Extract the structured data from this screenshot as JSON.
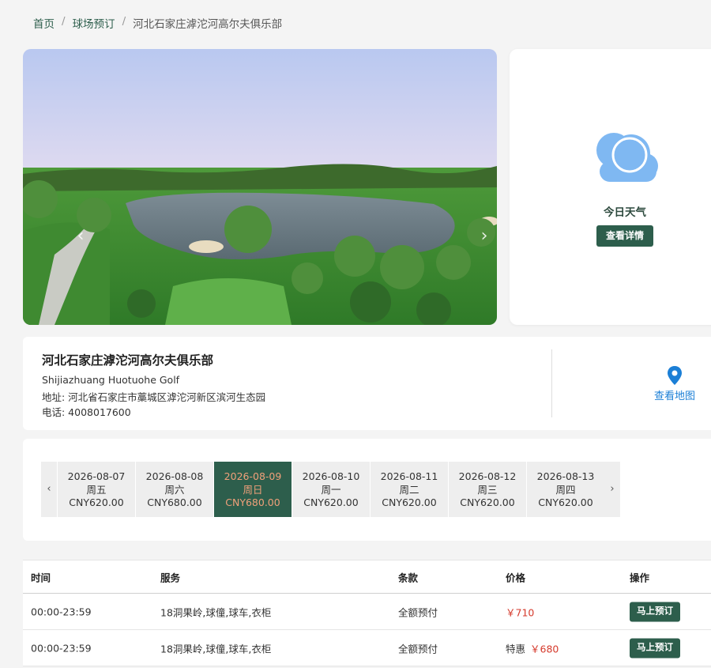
{
  "breadcrumb": {
    "home": "首页",
    "booking": "球场预订",
    "current": "河北石家庄滹沱河高尔夫俱乐部",
    "separator": "/"
  },
  "carousel": {
    "prev_icon": "‹",
    "next_icon": "›",
    "slide_count": 3,
    "active_slide": 1
  },
  "weather": {
    "label": "今日天气",
    "button": "查看详情",
    "icon": "cloud-icon"
  },
  "club": {
    "name": "河北石家庄滹沱河高尔夫俱乐部",
    "english_name": "Shijiazhuang Huotuohe Golf",
    "address": "地址: 河北省石家庄市藁城区滹沱河新区滨河生态园",
    "phone": "电话: 4008017600",
    "map_link": "查看地图",
    "map_icon": "location-pin-icon"
  },
  "date_picker": {
    "prev": "‹",
    "next": "›",
    "dates": [
      {
        "date": "2026-08-07",
        "weekday": "周五",
        "price": "CNY620.00",
        "active": false
      },
      {
        "date": "2026-08-08",
        "weekday": "周六",
        "price": "CNY680.00",
        "active": false
      },
      {
        "date": "2026-08-09",
        "weekday": "周日",
        "price": "CNY680.00",
        "active": true
      },
      {
        "date": "2026-08-10",
        "weekday": "周一",
        "price": "CNY620.00",
        "active": false
      },
      {
        "date": "2026-08-11",
        "weekday": "周二",
        "price": "CNY620.00",
        "active": false
      },
      {
        "date": "2026-08-12",
        "weekday": "周三",
        "price": "CNY620.00",
        "active": false
      },
      {
        "date": "2026-08-13",
        "weekday": "周四",
        "price": "CNY620.00",
        "active": false
      }
    ]
  },
  "tee_times": {
    "headers": {
      "time": "时间",
      "service": "服务",
      "terms": "条款",
      "price": "价格",
      "action": "操作"
    },
    "rows": [
      {
        "time": "00:00-23:59",
        "service": "18洞果岭,球僮,球车,衣柜",
        "terms": "全额预付",
        "promo": "",
        "price": "￥710",
        "button": "马上预订"
      },
      {
        "time": "00:00-23:59",
        "service": "18洞果岭,球僮,球车,衣柜",
        "terms": "全额预付",
        "promo": "特惠",
        "price": "￥680",
        "button": "马上预订"
      }
    ]
  },
  "colors": {
    "brand_green": "#2d5e4c",
    "price_red": "#d53a2c",
    "link_blue": "#1b7fd6",
    "active_date_text": "#f0a07a"
  }
}
